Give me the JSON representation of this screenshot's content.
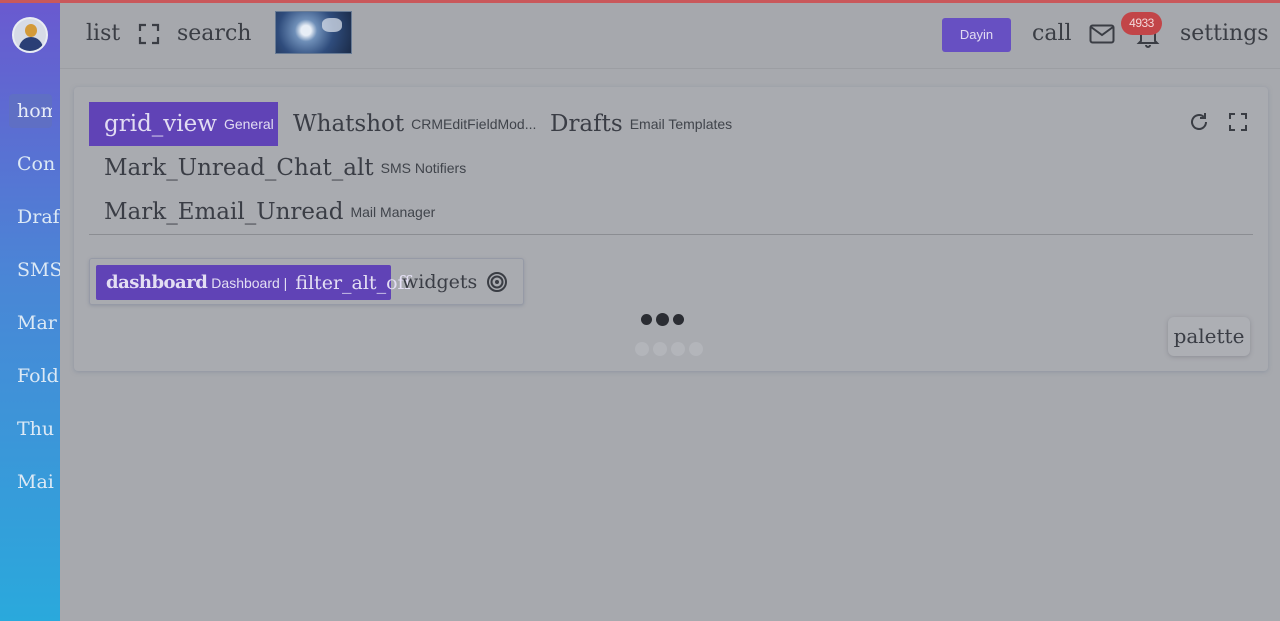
{
  "sidebar": {
    "items": [
      {
        "label": "hom"
      },
      {
        "label": "Con"
      },
      {
        "label": "Draf"
      },
      {
        "label": "SMS"
      },
      {
        "label": "Mar"
      },
      {
        "label": "Fold"
      },
      {
        "label": "Thu"
      },
      {
        "label": "Mai"
      }
    ]
  },
  "header": {
    "menu_icon_label": "list",
    "fullscreen_icon": "fullscreen-icon",
    "search_label": "search",
    "user_button": "Dayin",
    "call_label": "call",
    "notification_count": "4933",
    "settings_label": "settings"
  },
  "tabs": [
    {
      "icon_label": "grid_view",
      "label": "General",
      "active": true
    },
    {
      "icon_label": "Whatshot",
      "label": "CRMEditFieldMod..."
    },
    {
      "icon_label": "Drafts",
      "label": "Email Templates"
    },
    {
      "icon_label": "Mark_Unread_Chat_alt",
      "label": "SMS Notifiers"
    },
    {
      "icon_label": "Mark_Email_Unread",
      "label": "Mail Manager"
    }
  ],
  "widget_bar": {
    "active_icon": "dashboard",
    "active_label": "Dashboard |",
    "filter_label": "filter_alt_off",
    "widgets_label": "widgets"
  },
  "palette_label": "palette",
  "colors": {
    "accent": "#6043b6",
    "badge": "#c24548",
    "topline": "#c9585b"
  }
}
